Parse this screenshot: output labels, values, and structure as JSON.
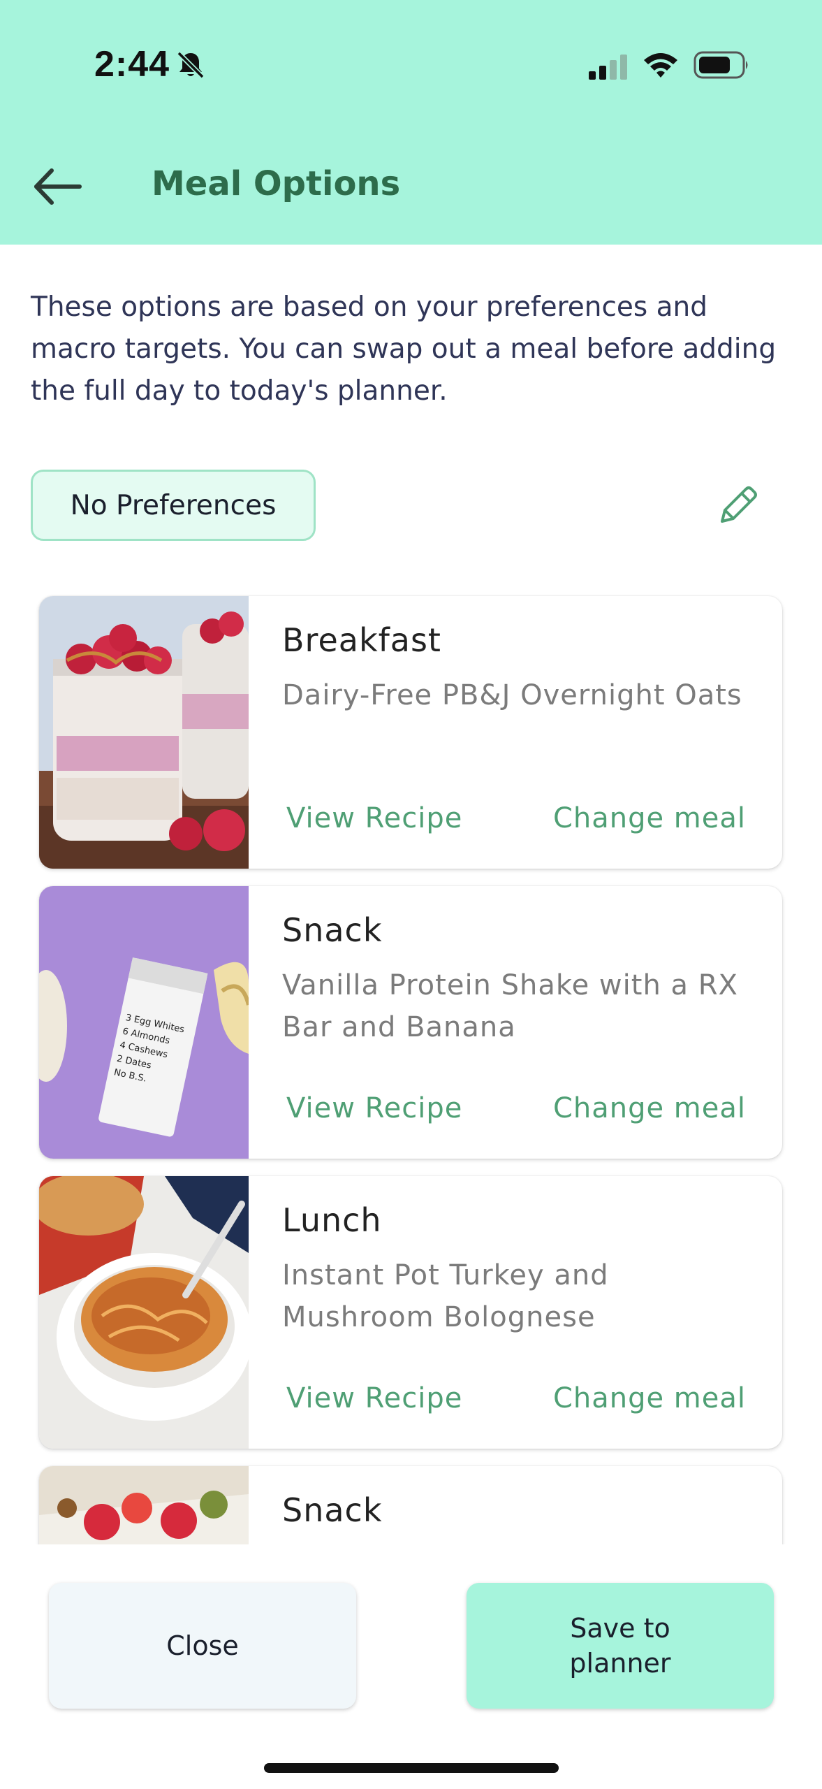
{
  "status_bar": {
    "time": "2:44"
  },
  "header": {
    "title": "Meal Options"
  },
  "intro_text": "These options are based on your preferences and macro targets. You can swap out a meal before adding the full day to today's planner.",
  "preferences_chip": "No Preferences",
  "meals": [
    {
      "type": "Breakfast",
      "name": "Dairy-Free PB&J Overnight Oats",
      "view_label": "View Recipe",
      "change_label": "Change meal"
    },
    {
      "type": "Snack",
      "name": "Vanilla Protein Shake with a RX Bar and Banana",
      "view_label": "View Recipe",
      "change_label": "Change meal",
      "bar_text": [
        "3 Egg Whites",
        "6 Almonds",
        "4 Cashews",
        "2 Dates",
        "No B.S."
      ]
    },
    {
      "type": "Lunch",
      "name": "Instant Pot Turkey and Mushroom Bolognese",
      "view_label": "View Recipe",
      "change_label": "Change meal"
    },
    {
      "type": "Snack"
    }
  ],
  "footer": {
    "close_label": "Close",
    "save_label": "Save to planner"
  },
  "colors": {
    "header_bg": "#a6f4dc",
    "accent_green": "#4f9f74",
    "title_green": "#2d6c4b"
  }
}
